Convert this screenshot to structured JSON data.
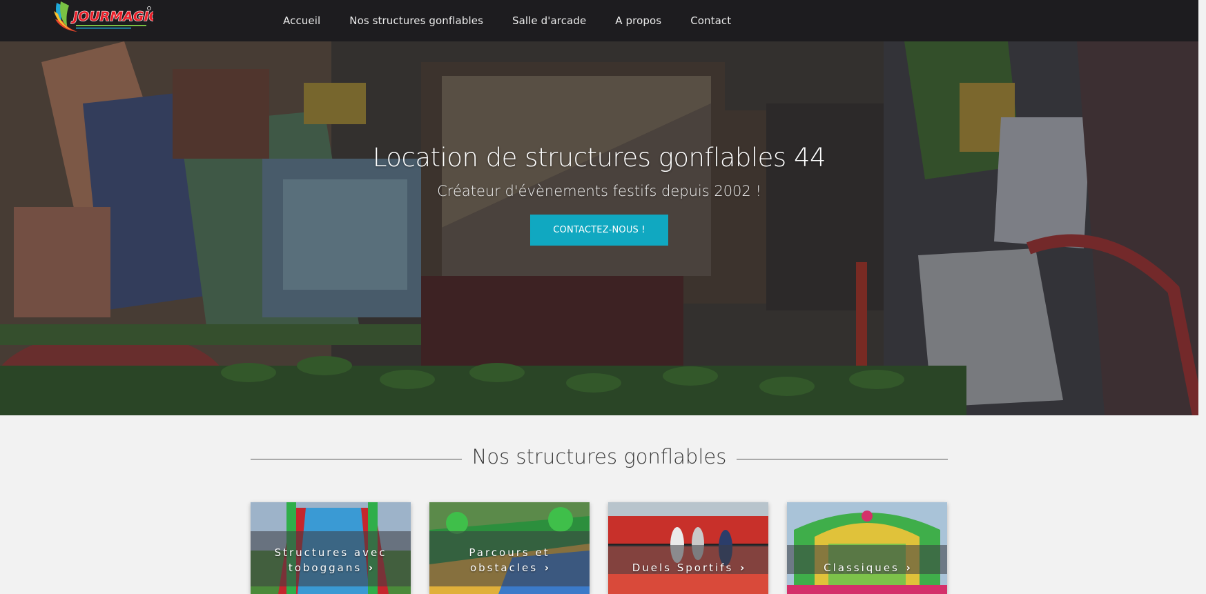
{
  "nav": {
    "logo_text": "JOURMAGIC",
    "items": [
      {
        "label": "Accueil"
      },
      {
        "label": "Nos structures gonflables"
      },
      {
        "label": "Salle d'arcade"
      },
      {
        "label": "A propos"
      },
      {
        "label": "Contact"
      }
    ]
  },
  "hero": {
    "title": "Location de structures gonflables 44",
    "subtitle": "Créateur d'évènements festifs depuis 2002 !",
    "cta_label": "CONTACTEZ-NOUS !",
    "accent_color": "#10a8c1"
  },
  "section": {
    "title": "Nos structures gonflables"
  },
  "cards": [
    {
      "line1": "Structures avec",
      "line2": "toboggans",
      "icon": "chevron-right-icon"
    },
    {
      "line1": "Parcours et",
      "line2": "obstacles",
      "icon": "chevron-right-icon"
    },
    {
      "line1": "",
      "line2": "Duels Sportifs",
      "icon": "chevron-right-icon"
    },
    {
      "line1": "",
      "line2": "Classiques",
      "icon": "chevron-right-icon"
    }
  ]
}
